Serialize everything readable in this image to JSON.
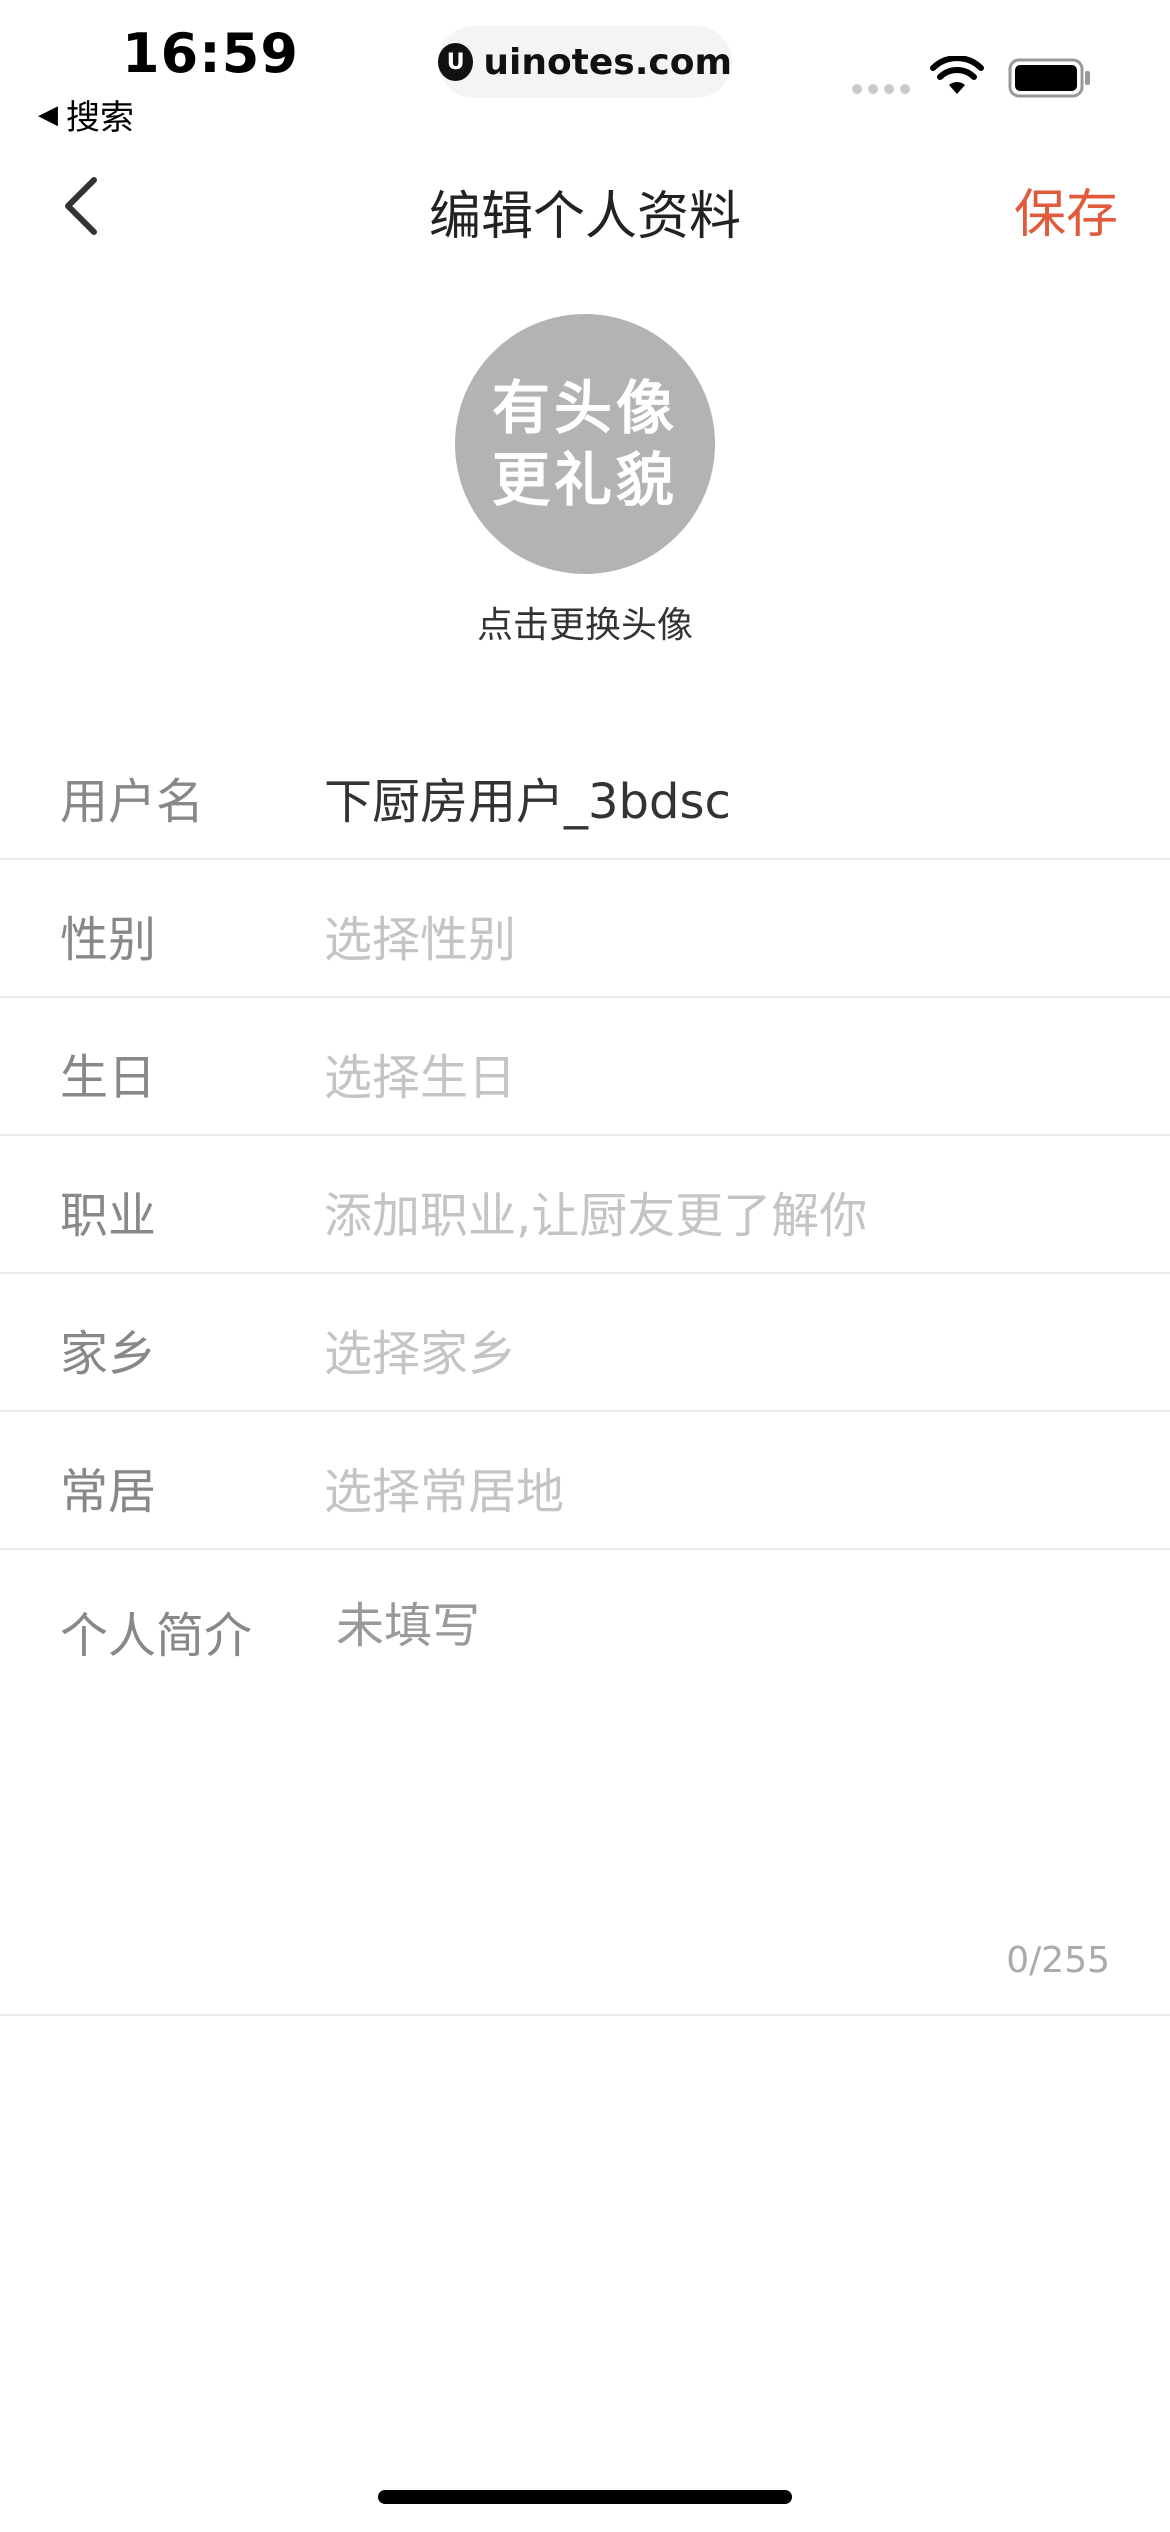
{
  "status": {
    "time": "16:59",
    "back_app": "搜索",
    "url": "uinotes.com",
    "url_logo": "U"
  },
  "nav": {
    "title": "编辑个人资料",
    "save": "保存"
  },
  "avatar": {
    "line1": "有头像",
    "line2": "更礼貌",
    "hint": "点击更换头像"
  },
  "form": {
    "username": {
      "label": "用户名",
      "value": "下厨房用户_3bdsc"
    },
    "gender": {
      "label": "性别",
      "placeholder": "选择性别"
    },
    "birthday": {
      "label": "生日",
      "placeholder": "选择生日"
    },
    "job": {
      "label": "职业",
      "placeholder": "添加职业,让厨友更了解你"
    },
    "hometown": {
      "label": "家乡",
      "placeholder": "选择家乡"
    },
    "residence": {
      "label": "常居",
      "placeholder": "选择常居地"
    },
    "bio": {
      "label": "个人简介",
      "placeholder": "未填写",
      "count": "0/255"
    }
  },
  "colors": {
    "accent": "#e05a3c",
    "avatar_bg": "#b3b3b3"
  }
}
